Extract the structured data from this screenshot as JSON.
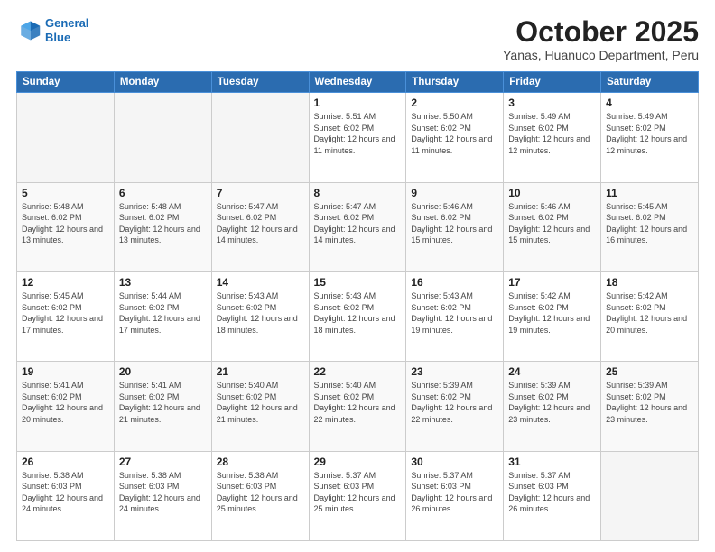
{
  "header": {
    "logo_line1": "General",
    "logo_line2": "Blue",
    "month_title": "October 2025",
    "subtitle": "Yanas, Huanuco Department, Peru"
  },
  "days_of_week": [
    "Sunday",
    "Monday",
    "Tuesday",
    "Wednesday",
    "Thursday",
    "Friday",
    "Saturday"
  ],
  "weeks": [
    [
      {
        "num": "",
        "info": ""
      },
      {
        "num": "",
        "info": ""
      },
      {
        "num": "",
        "info": ""
      },
      {
        "num": "1",
        "info": "Sunrise: 5:51 AM\nSunset: 6:02 PM\nDaylight: 12 hours\nand 11 minutes."
      },
      {
        "num": "2",
        "info": "Sunrise: 5:50 AM\nSunset: 6:02 PM\nDaylight: 12 hours\nand 11 minutes."
      },
      {
        "num": "3",
        "info": "Sunrise: 5:49 AM\nSunset: 6:02 PM\nDaylight: 12 hours\nand 12 minutes."
      },
      {
        "num": "4",
        "info": "Sunrise: 5:49 AM\nSunset: 6:02 PM\nDaylight: 12 hours\nand 12 minutes."
      }
    ],
    [
      {
        "num": "5",
        "info": "Sunrise: 5:48 AM\nSunset: 6:02 PM\nDaylight: 12 hours\nand 13 minutes."
      },
      {
        "num": "6",
        "info": "Sunrise: 5:48 AM\nSunset: 6:02 PM\nDaylight: 12 hours\nand 13 minutes."
      },
      {
        "num": "7",
        "info": "Sunrise: 5:47 AM\nSunset: 6:02 PM\nDaylight: 12 hours\nand 14 minutes."
      },
      {
        "num": "8",
        "info": "Sunrise: 5:47 AM\nSunset: 6:02 PM\nDaylight: 12 hours\nand 14 minutes."
      },
      {
        "num": "9",
        "info": "Sunrise: 5:46 AM\nSunset: 6:02 PM\nDaylight: 12 hours\nand 15 minutes."
      },
      {
        "num": "10",
        "info": "Sunrise: 5:46 AM\nSunset: 6:02 PM\nDaylight: 12 hours\nand 15 minutes."
      },
      {
        "num": "11",
        "info": "Sunrise: 5:45 AM\nSunset: 6:02 PM\nDaylight: 12 hours\nand 16 minutes."
      }
    ],
    [
      {
        "num": "12",
        "info": "Sunrise: 5:45 AM\nSunset: 6:02 PM\nDaylight: 12 hours\nand 17 minutes."
      },
      {
        "num": "13",
        "info": "Sunrise: 5:44 AM\nSunset: 6:02 PM\nDaylight: 12 hours\nand 17 minutes."
      },
      {
        "num": "14",
        "info": "Sunrise: 5:43 AM\nSunset: 6:02 PM\nDaylight: 12 hours\nand 18 minutes."
      },
      {
        "num": "15",
        "info": "Sunrise: 5:43 AM\nSunset: 6:02 PM\nDaylight: 12 hours\nand 18 minutes."
      },
      {
        "num": "16",
        "info": "Sunrise: 5:43 AM\nSunset: 6:02 PM\nDaylight: 12 hours\nand 19 minutes."
      },
      {
        "num": "17",
        "info": "Sunrise: 5:42 AM\nSunset: 6:02 PM\nDaylight: 12 hours\nand 19 minutes."
      },
      {
        "num": "18",
        "info": "Sunrise: 5:42 AM\nSunset: 6:02 PM\nDaylight: 12 hours\nand 20 minutes."
      }
    ],
    [
      {
        "num": "19",
        "info": "Sunrise: 5:41 AM\nSunset: 6:02 PM\nDaylight: 12 hours\nand 20 minutes."
      },
      {
        "num": "20",
        "info": "Sunrise: 5:41 AM\nSunset: 6:02 PM\nDaylight: 12 hours\nand 21 minutes."
      },
      {
        "num": "21",
        "info": "Sunrise: 5:40 AM\nSunset: 6:02 PM\nDaylight: 12 hours\nand 21 minutes."
      },
      {
        "num": "22",
        "info": "Sunrise: 5:40 AM\nSunset: 6:02 PM\nDaylight: 12 hours\nand 22 minutes."
      },
      {
        "num": "23",
        "info": "Sunrise: 5:39 AM\nSunset: 6:02 PM\nDaylight: 12 hours\nand 22 minutes."
      },
      {
        "num": "24",
        "info": "Sunrise: 5:39 AM\nSunset: 6:02 PM\nDaylight: 12 hours\nand 23 minutes."
      },
      {
        "num": "25",
        "info": "Sunrise: 5:39 AM\nSunset: 6:02 PM\nDaylight: 12 hours\nand 23 minutes."
      }
    ],
    [
      {
        "num": "26",
        "info": "Sunrise: 5:38 AM\nSunset: 6:03 PM\nDaylight: 12 hours\nand 24 minutes."
      },
      {
        "num": "27",
        "info": "Sunrise: 5:38 AM\nSunset: 6:03 PM\nDaylight: 12 hours\nand 24 minutes."
      },
      {
        "num": "28",
        "info": "Sunrise: 5:38 AM\nSunset: 6:03 PM\nDaylight: 12 hours\nand 25 minutes."
      },
      {
        "num": "29",
        "info": "Sunrise: 5:37 AM\nSunset: 6:03 PM\nDaylight: 12 hours\nand 25 minutes."
      },
      {
        "num": "30",
        "info": "Sunrise: 5:37 AM\nSunset: 6:03 PM\nDaylight: 12 hours\nand 26 minutes."
      },
      {
        "num": "31",
        "info": "Sunrise: 5:37 AM\nSunset: 6:03 PM\nDaylight: 12 hours\nand 26 minutes."
      },
      {
        "num": "",
        "info": ""
      }
    ]
  ]
}
